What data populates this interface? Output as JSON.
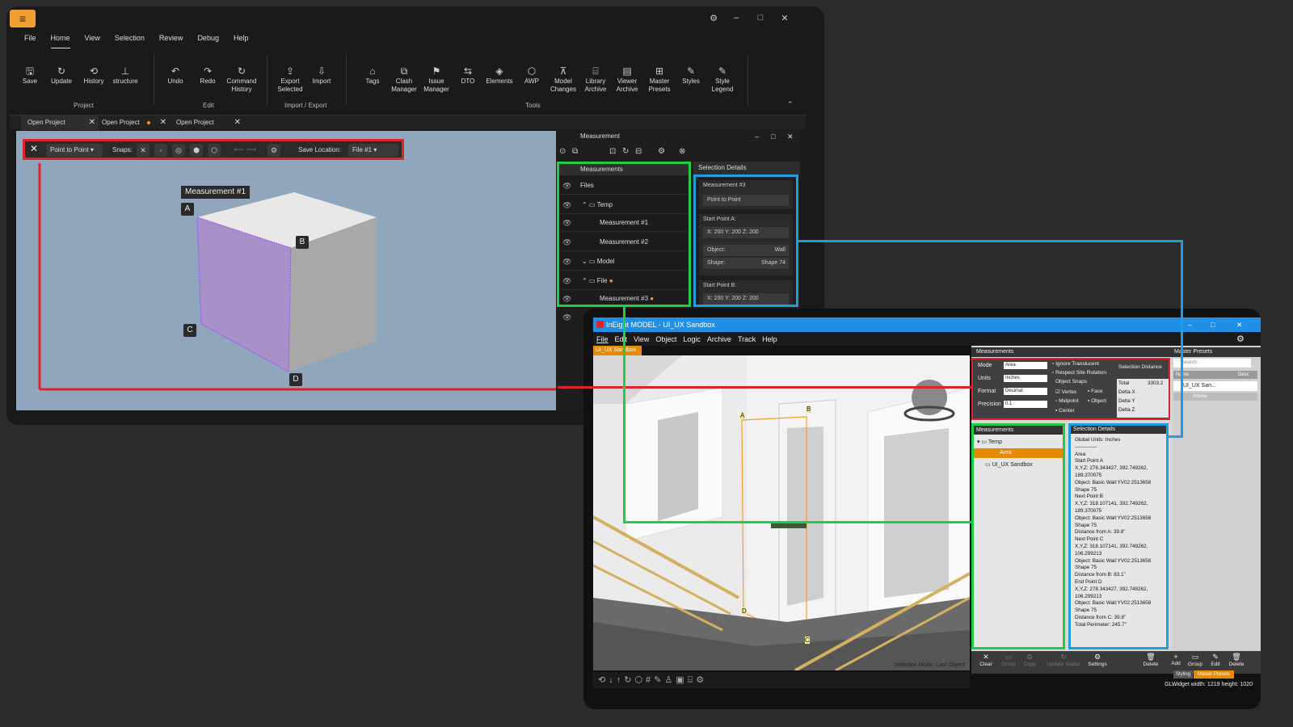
{
  "window1": {
    "menu": [
      "File",
      "Home",
      "View",
      "Selection",
      "Review",
      "Debug",
      "Help"
    ],
    "ribbon": {
      "buttons": [
        {
          "label": "Save",
          "icon": "save-icon"
        },
        {
          "label": "Update",
          "icon": "refresh-icon"
        },
        {
          "label": "History",
          "icon": "history-icon"
        },
        {
          "label": "structure",
          "icon": "structure-icon"
        },
        {
          "label": "Undo",
          "icon": "undo-icon"
        },
        {
          "label": "Redo",
          "icon": "redo-icon"
        },
        {
          "label": "Command History",
          "icon": "command-history-icon"
        },
        {
          "label": "Export Selected",
          "icon": "export-icon"
        },
        {
          "label": "Import",
          "icon": "import-icon"
        },
        {
          "label": "Tags",
          "icon": "tag-icon"
        },
        {
          "label": "Clash Manager",
          "icon": "clash-icon"
        },
        {
          "label": "Issue Manager",
          "icon": "flag-icon"
        },
        {
          "label": "DTO",
          "icon": "swap-icon"
        },
        {
          "label": "Elements",
          "icon": "elements-icon"
        },
        {
          "label": "AWP",
          "icon": "cube-icon"
        },
        {
          "label": "Model Changes",
          "icon": "model-changes-icon"
        },
        {
          "label": "Library Archive",
          "icon": "library-icon"
        },
        {
          "label": "Viewer Archive",
          "icon": "viewer-icon"
        },
        {
          "label": "Master Presets",
          "icon": "presets-icon"
        },
        {
          "label": "Styles",
          "icon": "pen-icon"
        },
        {
          "label": "Style Legend",
          "icon": "pen-icon"
        }
      ],
      "groups": [
        "Project",
        "Edit",
        "Import / Export",
        "Tools"
      ]
    },
    "tabs": [
      "Open Project",
      "Open Project",
      "Open Project"
    ],
    "toolbar": {
      "mode": "Point to Point",
      "snaps_label": "Snaps:",
      "save_location_label": "Save Location:",
      "save_location": "File #1"
    },
    "viewport": {
      "measurement_label": "Measurement #1",
      "points": [
        "A",
        "B",
        "C",
        "D"
      ]
    },
    "measurement_panel": {
      "title": "Measurement",
      "list_header": "Measurements",
      "rows": [
        "Files",
        "Temp",
        "Measurement #1",
        "Measurement #2",
        "Model",
        "File",
        "Measurement #3"
      ],
      "details_header": "Selection Details",
      "details": {
        "name": "Measurement #3",
        "type": "Point to Point",
        "start_a_label": "Start Point A:",
        "start_a_coords": "X: 200   Y: 200   Z: 200",
        "object_label": "Object:",
        "object_value": "Wall",
        "shape_label": "Shape:",
        "shape_value": "Shape 74",
        "start_b_label": "Start Point B:",
        "start_b_coords": "X: 200   Y: 200   Z: 200"
      }
    }
  },
  "window2": {
    "title": "InEight MODEL - UI_UX Sandbox",
    "menu": [
      "File",
      "Edit",
      "View",
      "Object",
      "Logic",
      "Archive",
      "Track",
      "Help"
    ],
    "tab": "UI_UX Sandbox",
    "view_labels": {
      "A": "A",
      "B": "B",
      "C": "C",
      "D": "D",
      "selection_mode": "Selection Mode: Last Object"
    },
    "measurements_header": "Measurements",
    "settings": {
      "mode_label": "Mode",
      "mode": "Area",
      "units_label": "Units",
      "units": "Inches",
      "format_label": "Format",
      "format": "Decimal",
      "precision_label": "Precision",
      "precision": "0.1",
      "ignore_translucent": "Ignore Translucent",
      "respect_site_rotation": "Respect Site Rotation",
      "object_snaps": "Object Snaps",
      "vertex": "Vertex",
      "face": "Face",
      "midpoint": "Midpoint",
      "object": "Object",
      "center": "Center",
      "selection_distance": "Selection Distance",
      "total_label": "Total",
      "total": "3303.2",
      "delta_x": "Delta X",
      "delta_y": "Delta Y",
      "delta_z": "Delta Z"
    },
    "tree": {
      "header": "Measurements",
      "items": [
        "Temp",
        "Area",
        "UI_UX Sandbox"
      ]
    },
    "details": {
      "header": "Selection Details",
      "lines": [
        "Global Units: Inches",
        "-------------",
        "Area",
        "Start Point A",
        "  X,Y,Z: 278.343427, 392.749262,",
        "189.370075",
        "    Object: Basic Wall:YV02:2513658",
        "Shape 75",
        "Next Point B",
        "  X,Y,Z: 318.107141, 392.749262,",
        "189.370075",
        "    Object: Basic Wall:YV02:2513658",
        "Shape 75",
        "  Distance from A: 39.8\"",
        "Next Point C",
        "  X,Y,Z: 318.107141, 392.749262,",
        "106.299213",
        "    Object: Basic Wall:YV02:2513658",
        "Shape 75",
        "  Distance from B: 83.1\"",
        "End Point D",
        "  X,Y,Z: 278.343427, 392.749262,",
        "106.299213",
        "    Object: Basic Wall:YV02:2513658",
        "Shape 75",
        "  Distance from C: 39.8\"",
        "Total Perimeter: 245.7\""
      ]
    },
    "presets": {
      "header": "Master Presets",
      "search": "Search",
      "name_col": "Name",
      "desc_col": "Desc",
      "item": "UI_UX San...",
      "home": "!Home"
    },
    "bottom": {
      "clear": "Clear",
      "group": "Group",
      "copy": "Copy",
      "update_status": "Update Status",
      "settings": "Settings",
      "delete": "Delete",
      "add": "Add",
      "group2": "Group",
      "edit": "Edit",
      "delete2": "Delete",
      "styling": "Styling",
      "master_presets": "Master Presets"
    },
    "status": "GLWidget  width: 1219     height: 1020"
  },
  "colors": {
    "red": "#e0232b",
    "green": "#22cc44",
    "blue": "#1e9ee0",
    "orange": "#f0a030",
    "title_blue": "#1f8fe8"
  }
}
